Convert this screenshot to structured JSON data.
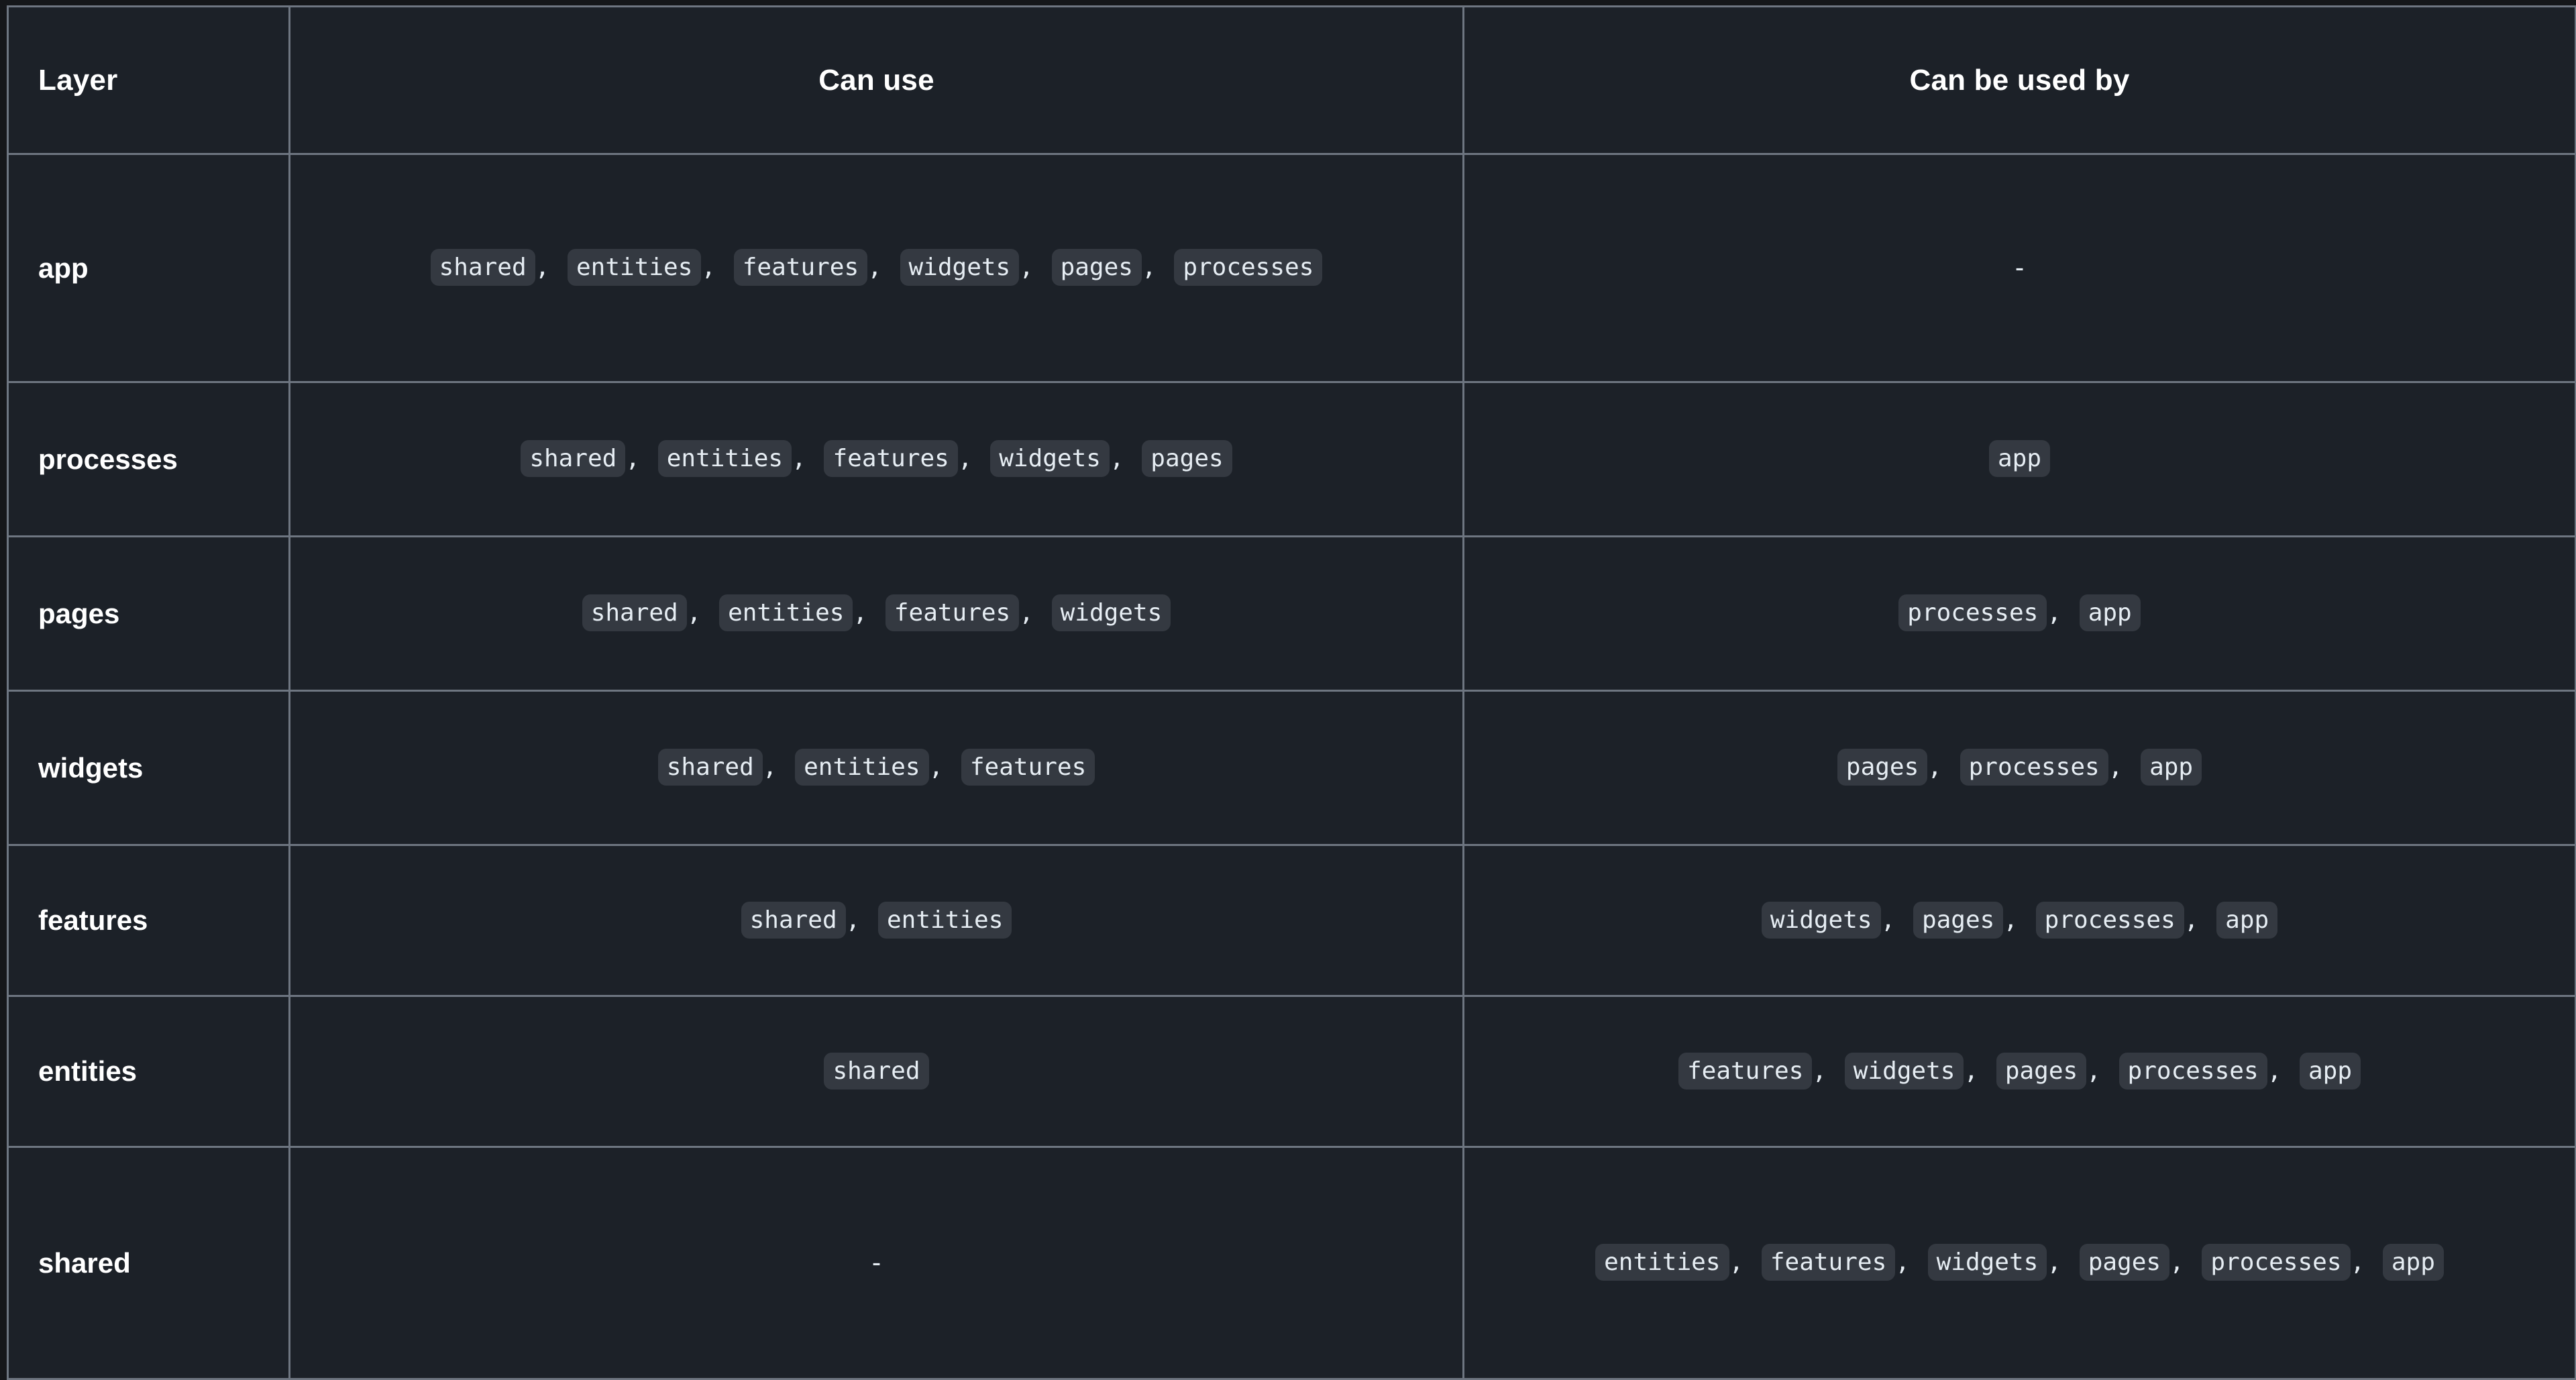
{
  "table": {
    "headers": {
      "layer": "Layer",
      "can_use": "Can use",
      "can_be_used_by": "Can be used by"
    },
    "empty_marker": "-",
    "separator": ",",
    "colors": {
      "page_background": "#15171a",
      "cell_background": "#1c2128",
      "border": "#6e7681",
      "chip_background": "#343941",
      "text": "#e6edf3",
      "heading_text": "#ffffff"
    },
    "rows": [
      {
        "layer": "app",
        "can_use": [
          "shared",
          "entities",
          "features",
          "widgets",
          "pages",
          "processes"
        ],
        "can_be_used_by": []
      },
      {
        "layer": "processes",
        "can_use": [
          "shared",
          "entities",
          "features",
          "widgets",
          "pages"
        ],
        "can_be_used_by": [
          "app"
        ]
      },
      {
        "layer": "pages",
        "can_use": [
          "shared",
          "entities",
          "features",
          "widgets"
        ],
        "can_be_used_by": [
          "processes",
          "app"
        ]
      },
      {
        "layer": "widgets",
        "can_use": [
          "shared",
          "entities",
          "features"
        ],
        "can_be_used_by": [
          "pages",
          "processes",
          "app"
        ]
      },
      {
        "layer": "features",
        "can_use": [
          "shared",
          "entities"
        ],
        "can_be_used_by": [
          "widgets",
          "pages",
          "processes",
          "app"
        ]
      },
      {
        "layer": "entities",
        "can_use": [
          "shared"
        ],
        "can_be_used_by": [
          "features",
          "widgets",
          "pages",
          "processes",
          "app"
        ]
      },
      {
        "layer": "shared",
        "can_use": [],
        "can_be_used_by": [
          "entities",
          "features",
          "widgets",
          "pages",
          "processes",
          "app"
        ]
      }
    ]
  }
}
